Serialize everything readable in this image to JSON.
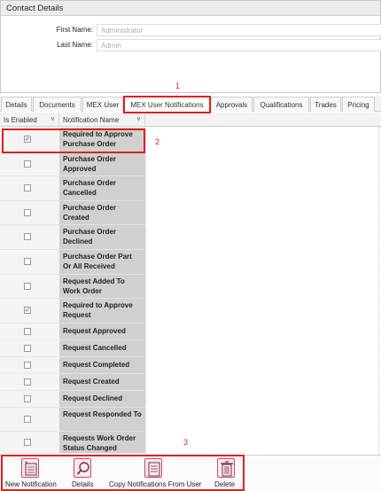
{
  "contact": {
    "title": "Contact Details",
    "first_name_label": "First Name:",
    "first_name_value": "Administrator",
    "last_name_label": "Last Name:",
    "last_name_value": "Admin"
  },
  "tabs": [
    {
      "label": "Details"
    },
    {
      "label": "Documents"
    },
    {
      "label": "MEX User"
    },
    {
      "label": "MEX User Notifications",
      "active": true
    },
    {
      "label": "Approvals"
    },
    {
      "label": "Qualifications"
    },
    {
      "label": "Trades"
    },
    {
      "label": "Pricing"
    }
  ],
  "grid": {
    "columns": [
      {
        "label": "Is Enabled"
      },
      {
        "label": "Notification Name"
      }
    ],
    "rows": [
      {
        "name": "Required to Approve Purchase Order",
        "enabled": true
      },
      {
        "name": "Purchase Order Approved",
        "enabled": false
      },
      {
        "name": "Purchase Order Cancelled",
        "enabled": false
      },
      {
        "name": "Purchase Order Created",
        "enabled": false
      },
      {
        "name": "Purchase Order Declined",
        "enabled": false
      },
      {
        "name": "Purchase Order Part Or All Received",
        "enabled": false
      },
      {
        "name": "Request Added To Work Order",
        "enabled": false
      },
      {
        "name": "Required to Approve Request",
        "enabled": true
      },
      {
        "name": "Request Approved",
        "enabled": false
      },
      {
        "name": "Request Cancelled",
        "enabled": false
      },
      {
        "name": "Request Completed",
        "enabled": false
      },
      {
        "name": "Request Created",
        "enabled": false
      },
      {
        "name": "Request Declined",
        "enabled": false
      },
      {
        "name": "Request Responded To",
        "enabled": false
      },
      {
        "name": "Requests Work Order Status Changed",
        "enabled": false
      }
    ]
  },
  "toolbar": {
    "buttons": [
      {
        "label": "New Notification",
        "icon": "new-notification-icon"
      },
      {
        "label": "Details",
        "icon": "magnifier-icon"
      },
      {
        "label": "Copy Notifications From User",
        "icon": "copy-list-icon"
      },
      {
        "label": "Delete",
        "icon": "trash-icon"
      }
    ]
  },
  "annotations": [
    "1",
    "2",
    "3"
  ],
  "colors": {
    "annotation": "#e02020",
    "toolbar_icon": "#c74a6b",
    "row_name_bg": "#d0d0d0"
  }
}
